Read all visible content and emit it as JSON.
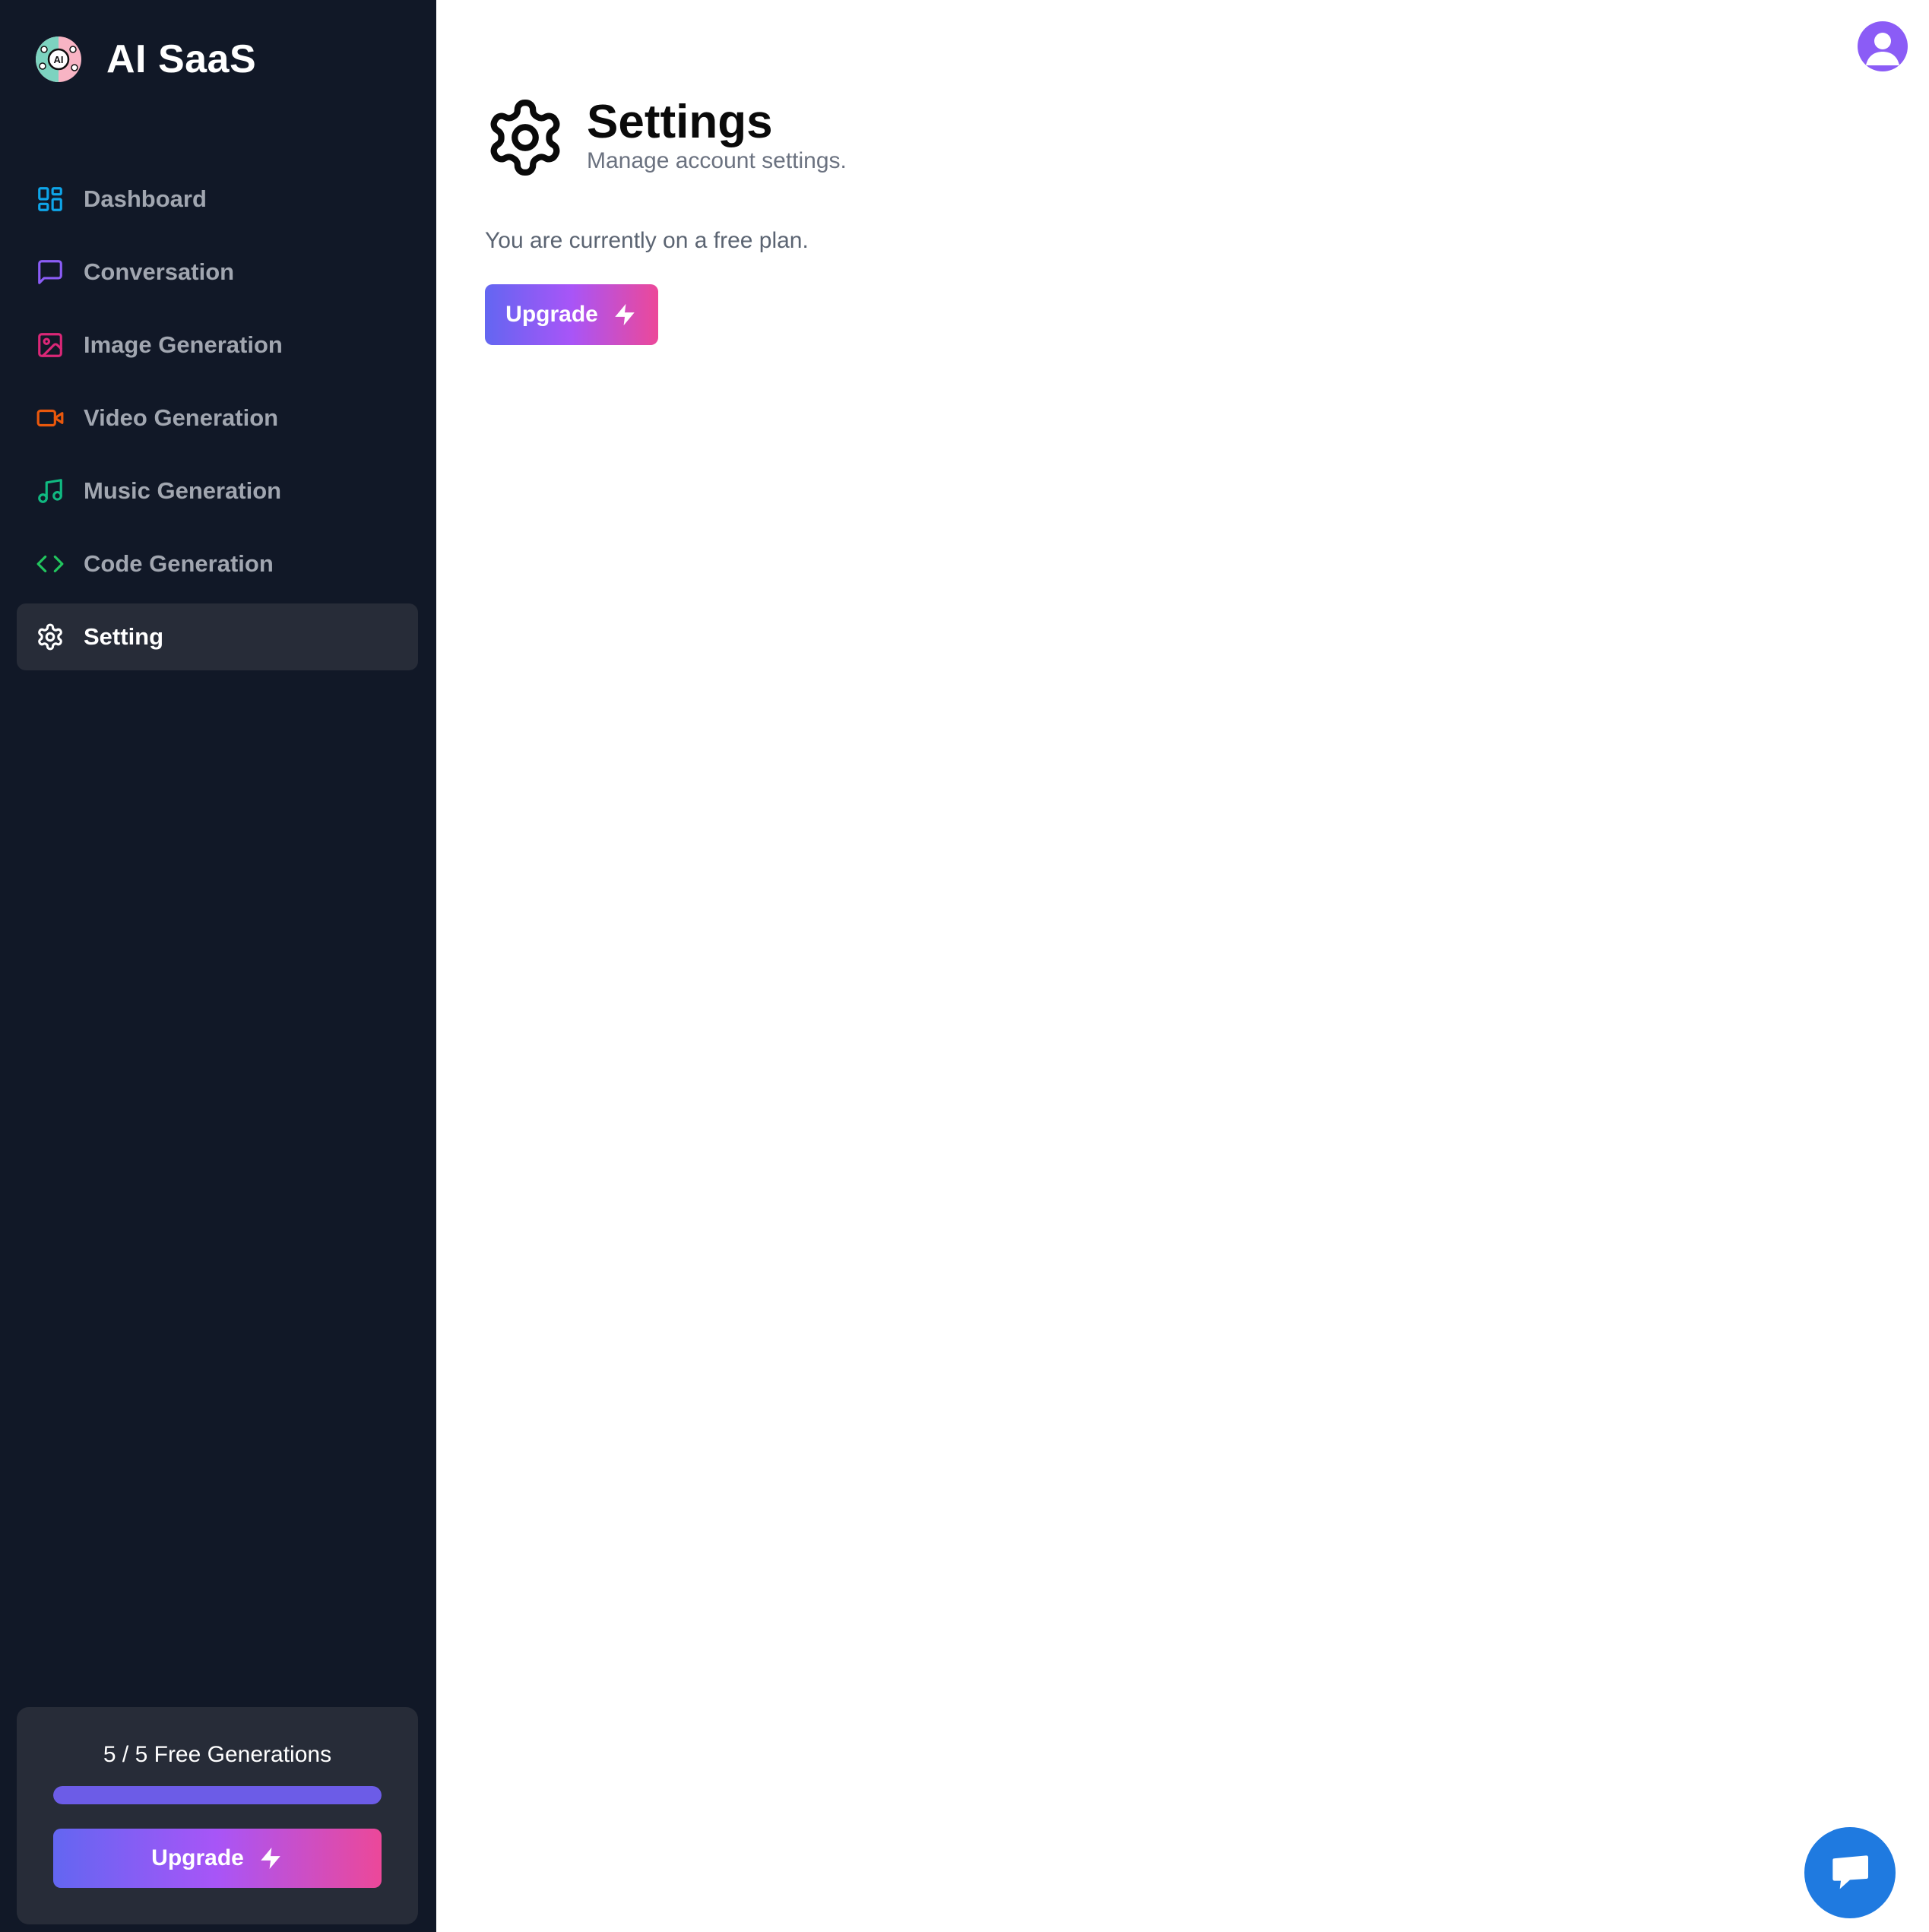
{
  "app": {
    "name": "AI SaaS",
    "logo_text": "AI"
  },
  "sidebar": {
    "items": [
      {
        "label": "Dashboard",
        "icon": "layout-dashboard-icon",
        "color": "#0ea5e9",
        "active": false
      },
      {
        "label": "Conversation",
        "icon": "message-square-icon",
        "color": "#8b5cf6",
        "active": false
      },
      {
        "label": "Image Generation",
        "icon": "image-icon",
        "color": "#db2777",
        "active": false
      },
      {
        "label": "Video Generation",
        "icon": "video-icon",
        "color": "#ea580c",
        "active": false
      },
      {
        "label": "Music Generation",
        "icon": "music-icon",
        "color": "#10b981",
        "active": false
      },
      {
        "label": "Code Generation",
        "icon": "code-icon",
        "color": "#22c55e",
        "active": false
      },
      {
        "label": "Setting",
        "icon": "settings-icon",
        "color": "#ffffff",
        "active": true
      }
    ],
    "free_card": {
      "usage_text": "5 / 5 Free Generations",
      "progress_fraction": 1.0,
      "upgrade_label": "Upgrade"
    }
  },
  "header": {
    "title": "Settings",
    "subtitle": "Manage account settings."
  },
  "main": {
    "plan_text": "You are currently on a free plan.",
    "upgrade_label": "Upgrade"
  },
  "colors": {
    "sidebar_bg": "#111827",
    "active_item_bg": "#272c38",
    "gradient_start": "#6366f1",
    "gradient_mid": "#a855f7",
    "gradient_end": "#ec4899",
    "avatar": "#8b5cf6",
    "chat_button": "#1f7ae0"
  }
}
